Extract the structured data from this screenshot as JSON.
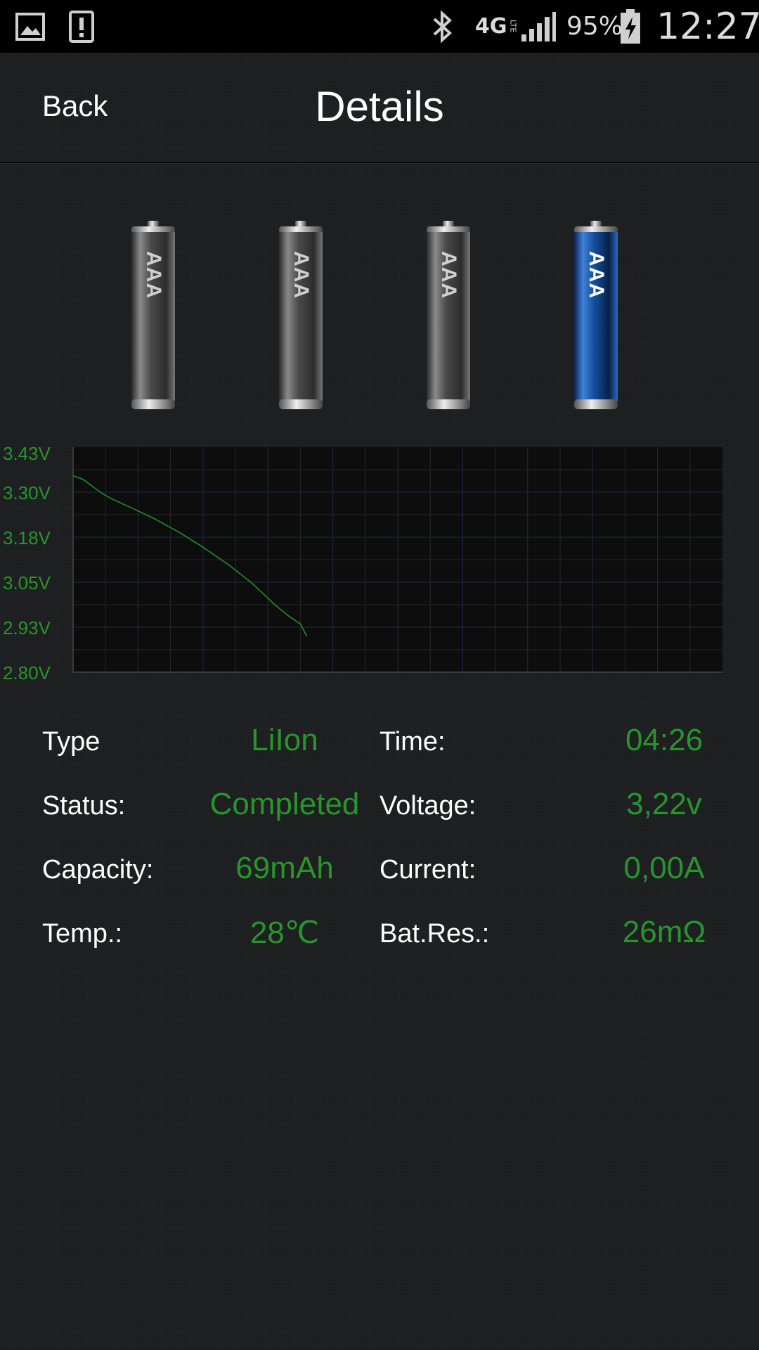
{
  "status_bar": {
    "battery_percent": "95%",
    "time": "12:27",
    "network": "4G",
    "network_sub": "LTE",
    "icons": [
      "gallery-icon",
      "alert-icon",
      "bluetooth-icon",
      "4g-lte-icon",
      "signal-icon",
      "battery-charging-icon"
    ]
  },
  "header": {
    "back_label": "Back",
    "title": "Details"
  },
  "batteries": [
    {
      "label": "AAA",
      "selected": false
    },
    {
      "label": "AAA",
      "selected": false
    },
    {
      "label": "AAA",
      "selected": false
    },
    {
      "label": "AAA",
      "selected": true
    }
  ],
  "chart_data": {
    "type": "line",
    "title": "",
    "xlabel": "",
    "ylabel": "",
    "y_ticks": [
      "3.43V",
      "3.30V",
      "3.18V",
      "3.05V",
      "2.93V",
      "2.80V"
    ],
    "ylim": [
      2.8,
      3.43
    ],
    "xlim": [
      0,
      20
    ],
    "grid": true,
    "series": [
      {
        "color": "#1f8f26",
        "x": [
          0,
          0.3,
          0.6,
          0.9,
          1.2,
          1.8,
          2.5,
          3.3,
          4.0,
          4.8,
          5.5,
          6.2,
          6.6,
          7.0,
          7.2
        ],
        "y": [
          3.35,
          3.34,
          3.32,
          3.3,
          3.285,
          3.26,
          3.23,
          3.19,
          3.15,
          3.1,
          3.05,
          2.99,
          2.96,
          2.935,
          2.9
        ]
      }
    ]
  },
  "details": {
    "left": [
      {
        "label": "Type",
        "value": "LiIon"
      },
      {
        "label": "Status:",
        "value": "Completed"
      },
      {
        "label": "Capacity:",
        "value": "69mAh"
      },
      {
        "label": "Temp.:",
        "value": "28℃"
      }
    ],
    "right": [
      {
        "label": "Time:",
        "value": "04:26"
      },
      {
        "label": "Voltage:",
        "value": "3,22v"
      },
      {
        "label": "Current:",
        "value": "0,00A"
      },
      {
        "label": "Bat.Res.:",
        "value": "26mΩ"
      }
    ]
  },
  "colors": {
    "accent_green": "#27952c",
    "selected_battery": "#1d5fb5",
    "background": "#1d1e20"
  }
}
